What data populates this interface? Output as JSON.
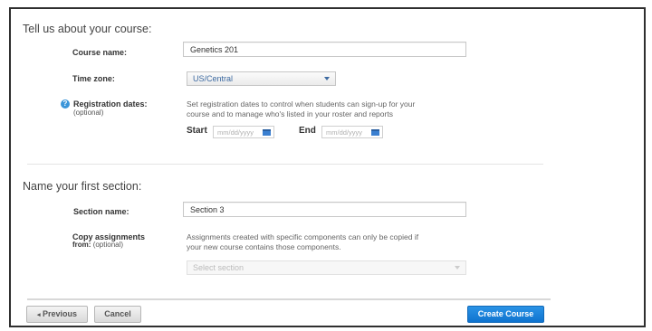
{
  "course": {
    "heading": "Tell us about your course:",
    "course_name_label": "Course name:",
    "course_name_value": "Genetics 201",
    "time_zone_label": "Time zone:",
    "time_zone_value": "US/Central",
    "registration_label": "Registration dates:",
    "registration_optional": "(optional)",
    "registration_help_line1": "Set registration dates to control when students can sign-up for your",
    "registration_help_line2": "course and to manage who's listed in your roster and reports",
    "start_label": "Start",
    "start_placeholder": "mm/dd/yyyy",
    "end_label": "End",
    "end_placeholder": "mm/dd/yyyy"
  },
  "section": {
    "heading": "Name your first section:",
    "section_name_label": "Section name:",
    "section_name_value": "Section 3",
    "copy_label": "Copy assignments",
    "copy_label_from": "from:",
    "copy_optional": "(optional)",
    "copy_help_line1": "Assignments created with specific components can only be copied if",
    "copy_help_line2": "your new course contains those components.",
    "select_section_value": "Select section"
  },
  "footer": {
    "previous_label": "Previous",
    "cancel_label": "Cancel",
    "create_label": "Create Course"
  },
  "colors": {
    "accent": "#0f73cf",
    "link": "#3d6aa1"
  }
}
